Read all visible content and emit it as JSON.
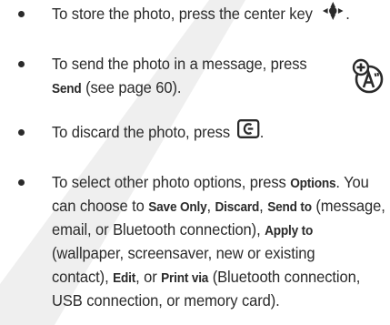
{
  "bullets": [
    {
      "id": "store",
      "line1": "To store the photo, press the center key"
    },
    {
      "id": "send",
      "line1": "To send the photo in a message, press",
      "key_send": "Send",
      "line2_rest": " (see page 60)."
    },
    {
      "id": "discard",
      "line1": "To discard the photo, press",
      "end_punct": "."
    },
    {
      "id": "options",
      "line1_pre": "To select other photo options, press ",
      "key_options": "Options",
      "line1_post": ". You",
      "line2_pre": "can choose to ",
      "key_save_only": "Save Only",
      "sep1": ", ",
      "key_discard": "Discard",
      "sep2": ", ",
      "key_send_to": "Send to",
      "line2_post": " (message,",
      "line3": "email, or Bluetooth connection),",
      "key_apply_to": "Apply to",
      "line4": "(wallpaper, screensaver, new or existing",
      "line5_pre": "contact), ",
      "key_edit": "Edit",
      "line5_mid": ", or ",
      "key_print_via": "Print via",
      "line5_post": " (Bluetooth connection,",
      "line6": "USB connection, or memory card)."
    }
  ],
  "icons": {
    "center_key": "center-nav-key-icon",
    "send_feature": "new-message-feature-icon",
    "clear_key": "clear-back-key-icon"
  },
  "colors": {
    "text": "#2a2a2a",
    "watermark": "#ededed"
  }
}
